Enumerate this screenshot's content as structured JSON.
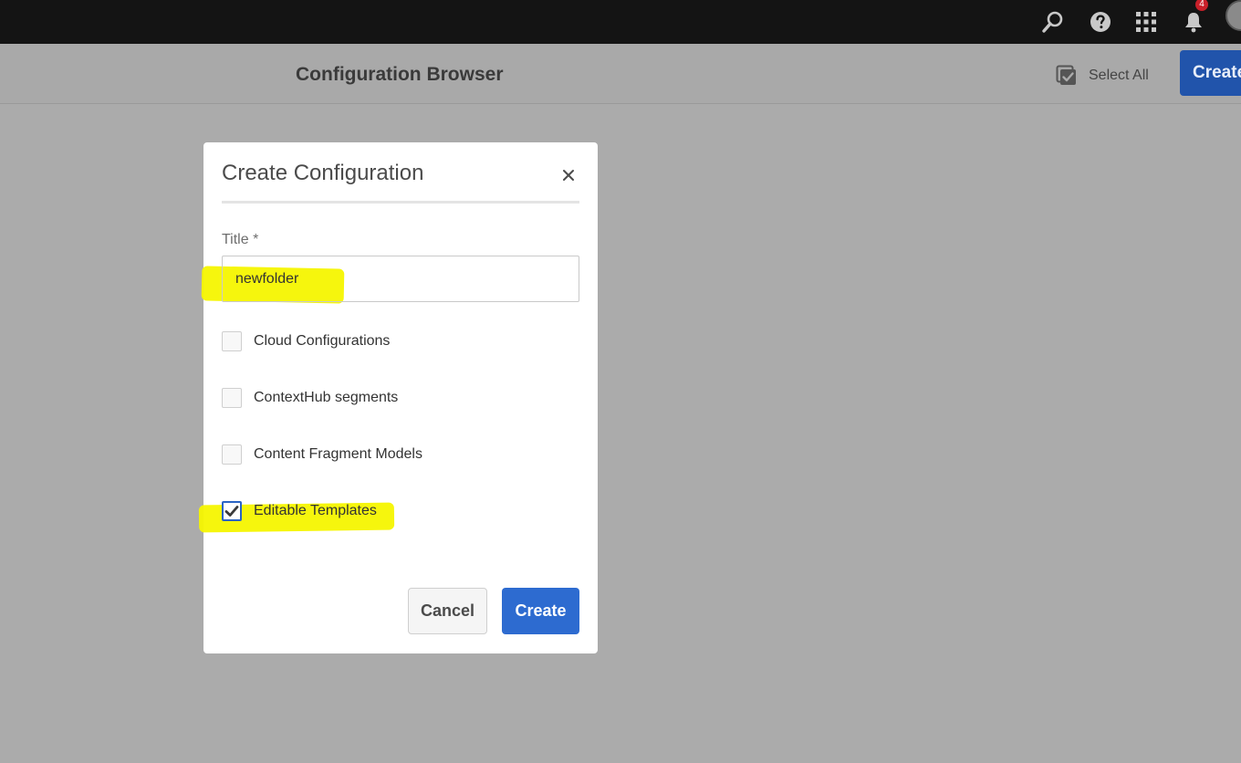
{
  "topbar": {
    "icons": [
      "search-icon",
      "help-icon",
      "apps-grid-icon",
      "bell-icon",
      "avatar"
    ],
    "notification_count": "4"
  },
  "header": {
    "title": "Configuration Browser",
    "select_all_label": "Select All",
    "create_label": "Create"
  },
  "dialog": {
    "title": "Create Configuration",
    "close_icon": "close-icon",
    "title_field_label": "Title *",
    "title_field_value": "newfolder",
    "checkboxes": [
      {
        "label": "Cloud Configurations",
        "checked": false
      },
      {
        "label": "ContextHub segments",
        "checked": false
      },
      {
        "label": "Content Fragment Models",
        "checked": false
      },
      {
        "label": "Editable Templates",
        "checked": true
      }
    ],
    "cancel_label": "Cancel",
    "create_label": "Create"
  },
  "colors": {
    "topbar": "#141414",
    "backdrop": "#ababab",
    "primary_button": "#2d6bd0",
    "highlight": "#f6f500",
    "badge": "#c9202a"
  }
}
